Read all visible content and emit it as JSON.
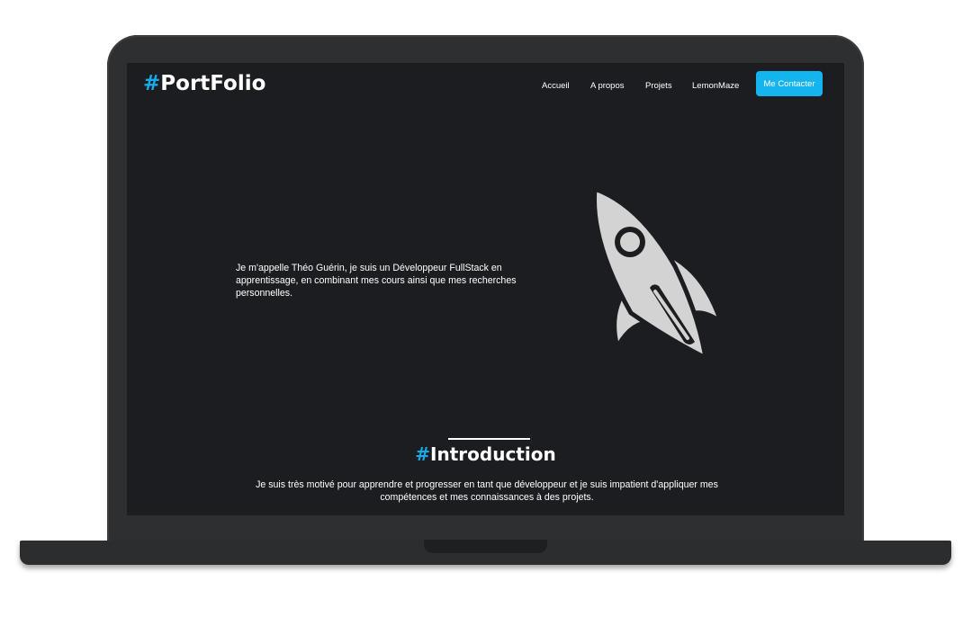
{
  "header": {
    "logo_hash": "#",
    "logo_text": "PortFolio",
    "nav": [
      "Accueil",
      "A propos",
      "Projets",
      "LemonMaze"
    ],
    "cta_label": "Me Contacter"
  },
  "hero": {
    "text": "Je m'appelle Théo Guérin, je suis un Développeur FullStack en apprentissage, en combinant mes cours ainsi que mes recherches personnelles.",
    "icon": "rocket-icon"
  },
  "intro": {
    "title_hash": "#",
    "title_text": "Introduction",
    "text": "Je suis très motivé pour apprendre et progresser en tant que développeur et je suis impatient d'appliquer mes compétences et mes connaissances à des projets."
  },
  "colors": {
    "accent": "#14b4ee",
    "background": "#1b1d20",
    "frame": "#2e2f31"
  }
}
